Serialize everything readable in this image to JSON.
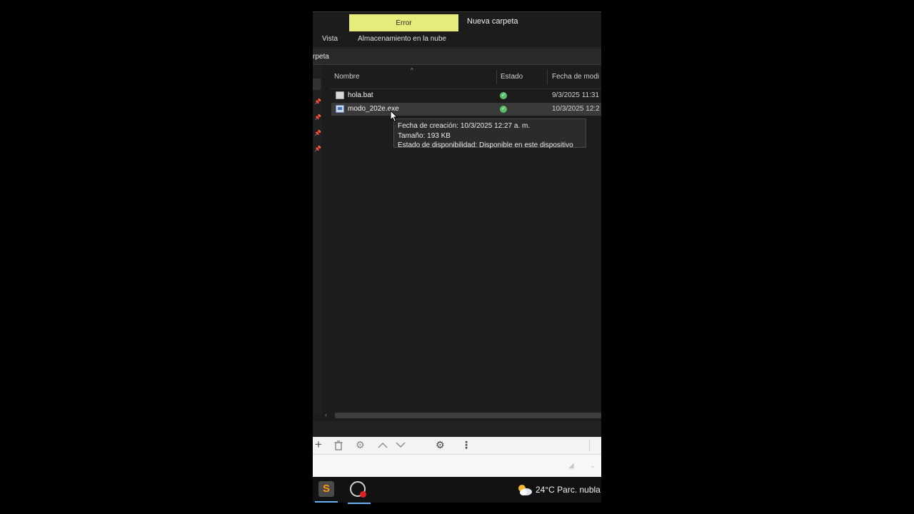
{
  "ribbon": {
    "error_button": "Error",
    "new_folder": "Nueva carpeta",
    "menu": [
      "Vista",
      "Almacenamiento en la nube"
    ]
  },
  "address": {
    "text": "rpeta"
  },
  "columns": {
    "name": "Nombre",
    "status": "Estado",
    "date": "Fecha de modi"
  },
  "files": [
    {
      "name": "hola.bat",
      "icon": "bat-file-icon",
      "status": "synced",
      "date": "9/3/2025 11:31"
    },
    {
      "name": "modo_202e.exe",
      "icon": "exe-file-icon",
      "status": "synced",
      "date": "10/3/2025 12:2"
    }
  ],
  "tooltip": {
    "line1": "Fecha de creación: 10/3/2025 12:27 a. m.",
    "line2": "Tamaño: 193 KB",
    "line3": "Estado de disponibilidad: Disponible en este dispositivo"
  },
  "taskbar": {
    "weather": "24°C  Parc. nubla"
  },
  "colors": {
    "error_button_bg": "#e6eb7a",
    "status_green": "#5bbf6a",
    "window_bg": "#1c1c1c"
  }
}
